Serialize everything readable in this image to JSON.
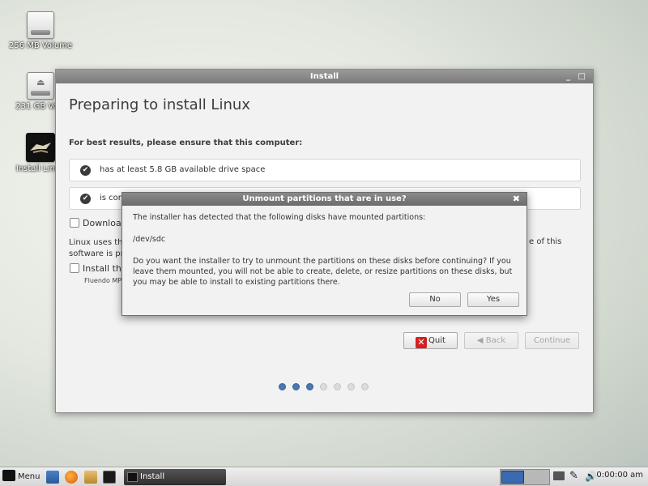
{
  "desktop": {
    "icons": [
      {
        "label": "256 MB Volume"
      },
      {
        "label": "231 GB Volu"
      },
      {
        "label": "Install Linux"
      }
    ]
  },
  "window": {
    "title": "Install",
    "controls": "_ □",
    "heading": "Preparing to install Linux",
    "subtitle": "For best results, please ensure that this computer:",
    "requirements": [
      {
        "text": "has at least 5.8 GB available drive space"
      },
      {
        "text": "is con"
      }
    ],
    "download_checkbox_label": "Download",
    "body_line1": "Linux uses thi",
    "body_line2": "software is pro",
    "body_right_fragment": "e of this",
    "install_checkbox_label": "Install this",
    "small_text": "Fluendo MP3",
    "buttons": {
      "quit": "Quit",
      "back": "Back",
      "continue": "Continue"
    },
    "progress": {
      "total_steps": 7,
      "completed_steps": 3
    }
  },
  "dialog": {
    "title": "Unmount partitions that are in use?",
    "close_glyph": "✖",
    "line1": "The installer has detected that the following disks have mounted partitions:",
    "device": "/dev/sdc",
    "question": "Do you want the installer to try to unmount the partitions on these disks before continuing?  If you leave them mounted, you will not be able to create, delete, or resize partitions on these disks, but you may be able to install to existing partitions there.",
    "no_label": "No",
    "yes_label": "Yes"
  },
  "taskbar": {
    "menu_label": "Menu",
    "task_label": "Install",
    "clock": "0:00:00 am"
  }
}
